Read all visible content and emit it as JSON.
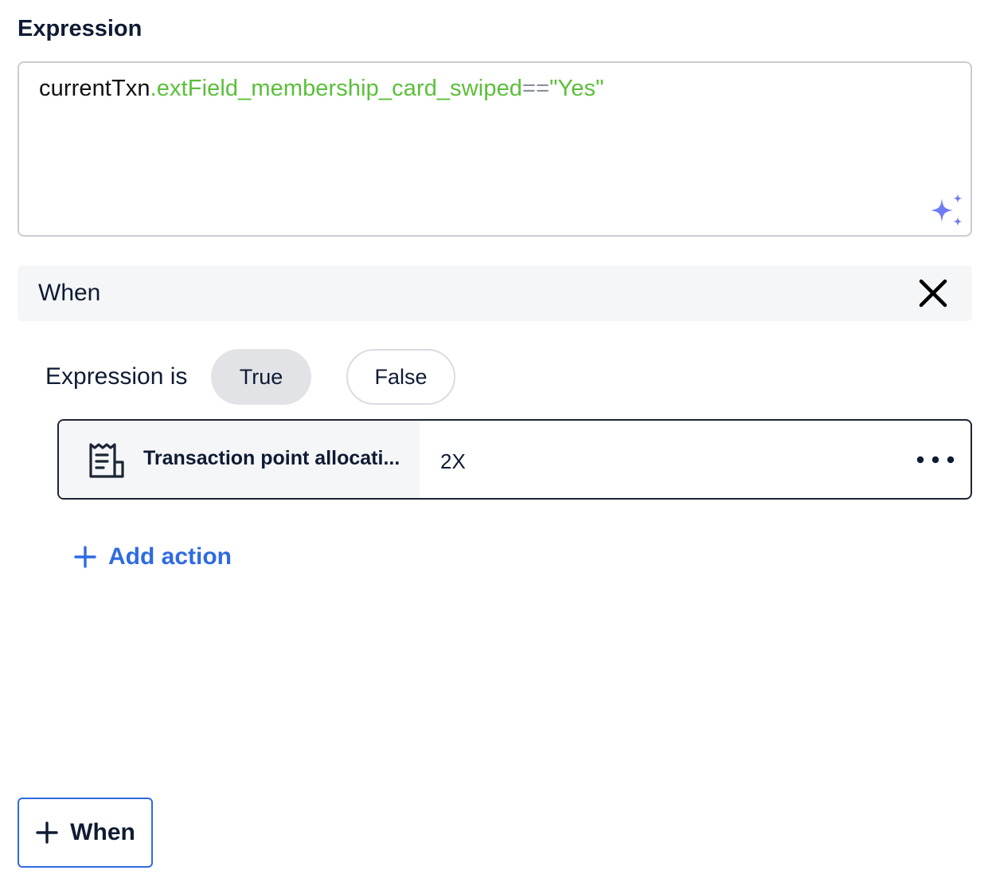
{
  "expression": {
    "label": "Expression",
    "tokens": {
      "object": "currentTxn",
      "field": ".extField_membership_card_swiped",
      "operator": "==",
      "value": "\"Yes\""
    },
    "ai_icon": "sparkle-icon",
    "ai_icon_color": "#6d7cf5"
  },
  "when_block": {
    "title": "When",
    "close_icon": "close-icon",
    "expression_is_label": "Expression is",
    "options": [
      {
        "label": "True",
        "selected": true
      },
      {
        "label": "False",
        "selected": false
      }
    ],
    "action": {
      "icon": "receipt-icon",
      "name": "Transaction point allocati...",
      "value": "2X",
      "menu_icon": "more-horizontal-icon"
    },
    "add_action_label": "Add action"
  },
  "add_when_label": "When",
  "colors": {
    "accent": "#2f6be0",
    "expression_field": "#5bbf3a",
    "text_dark": "#0f1b33"
  }
}
